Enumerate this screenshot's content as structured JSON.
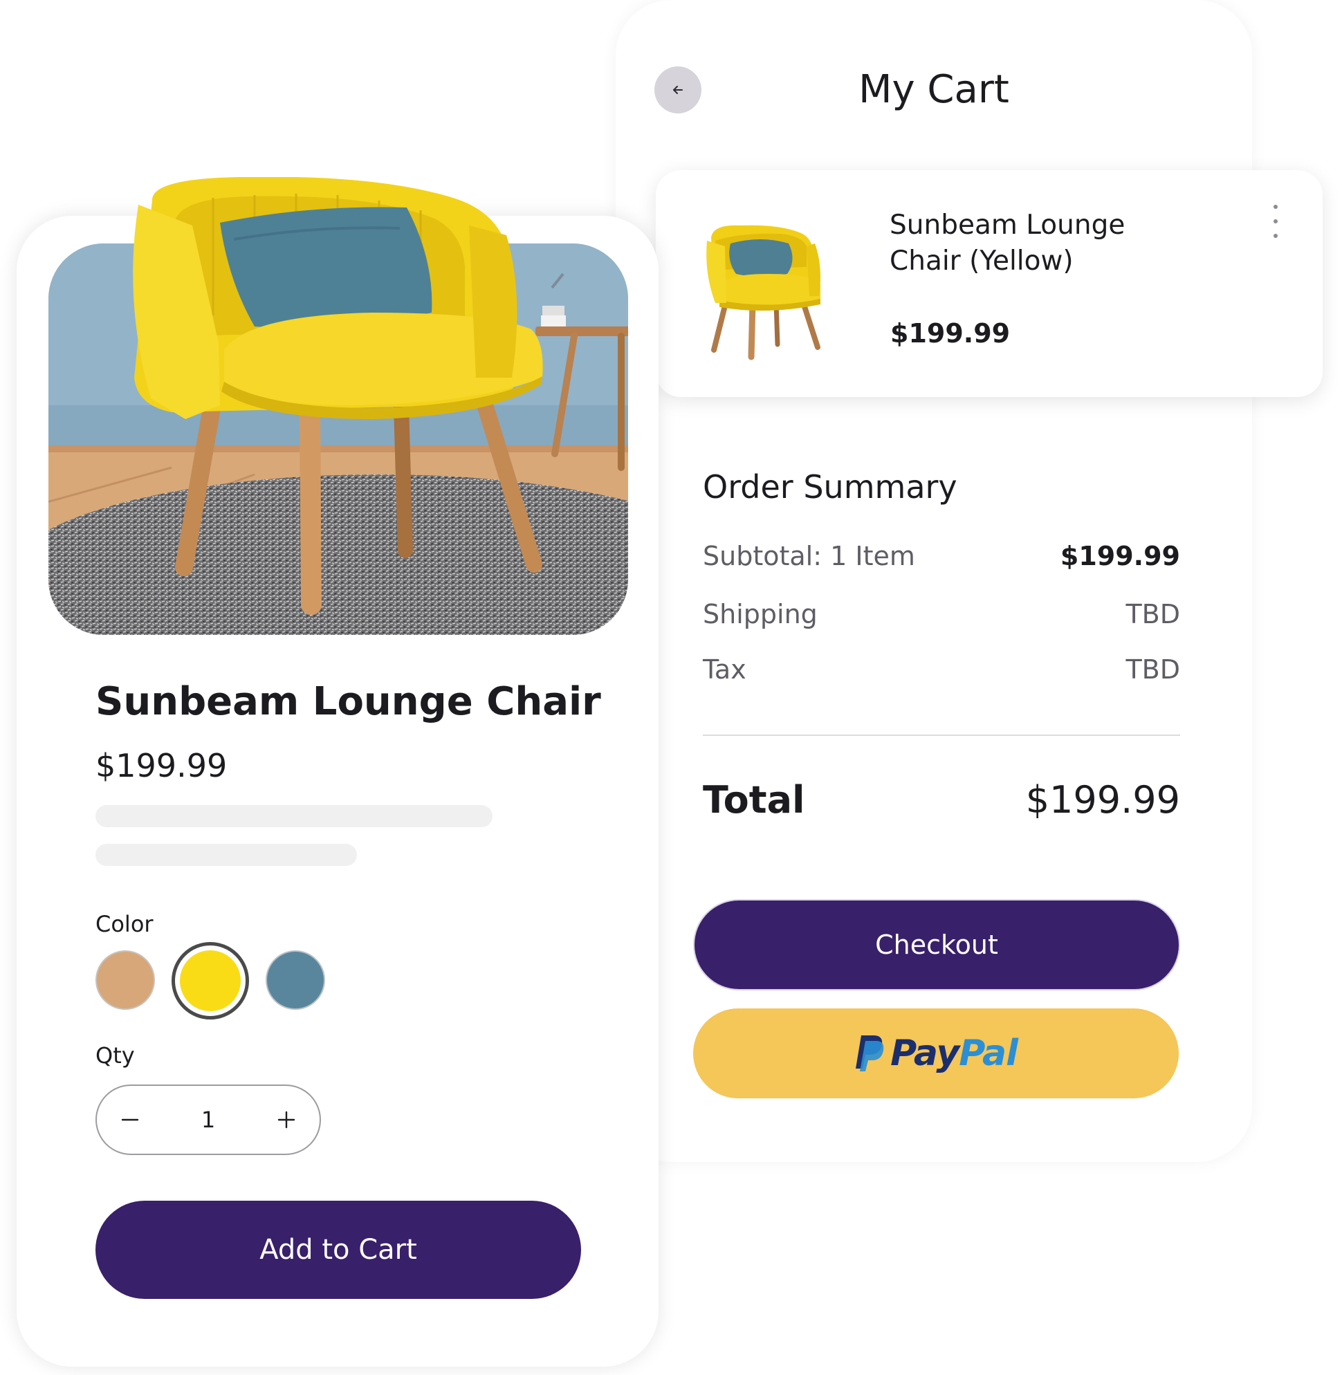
{
  "cart": {
    "title": "My Cart",
    "item": {
      "name": "Sunbeam Lounge Chair (Yellow)",
      "price": "$199.99"
    },
    "summary": {
      "heading": "Order Summary",
      "rows": [
        {
          "label": "Subtotal: 1 Item",
          "value": "$199.99"
        },
        {
          "label": "Shipping",
          "value": "TBD"
        },
        {
          "label": "Tax",
          "value": "TBD"
        }
      ],
      "total_label": "Total",
      "total_value": "$199.99"
    },
    "checkout_label": "Checkout",
    "paypal": {
      "pay": "Pay",
      "pal": "Pal"
    }
  },
  "product": {
    "title": "Sunbeam Lounge Chair",
    "price": "$199.99",
    "color_label": "Color",
    "colors": [
      {
        "name": "tan",
        "hex": "#d7a77a"
      },
      {
        "name": "yellow",
        "hex": "#f9dc16",
        "selected": true
      },
      {
        "name": "blue",
        "hex": "#5a869d"
      }
    ],
    "qty_label": "Qty",
    "qty_value": "1",
    "add_to_cart_label": "Add to Cart"
  },
  "icons": {
    "back": "arrow-left-icon",
    "menu": "more-vertical-icon",
    "minus": "minus-icon",
    "plus": "plus-icon",
    "paypal": "paypal-icon"
  },
  "colors": {
    "primary": "#39206a",
    "paypal_button": "#f5c658",
    "chair_yellow": "#f3d21a",
    "wall_blue": "#8fb0c6",
    "pillow_blue": "#4f8196"
  }
}
